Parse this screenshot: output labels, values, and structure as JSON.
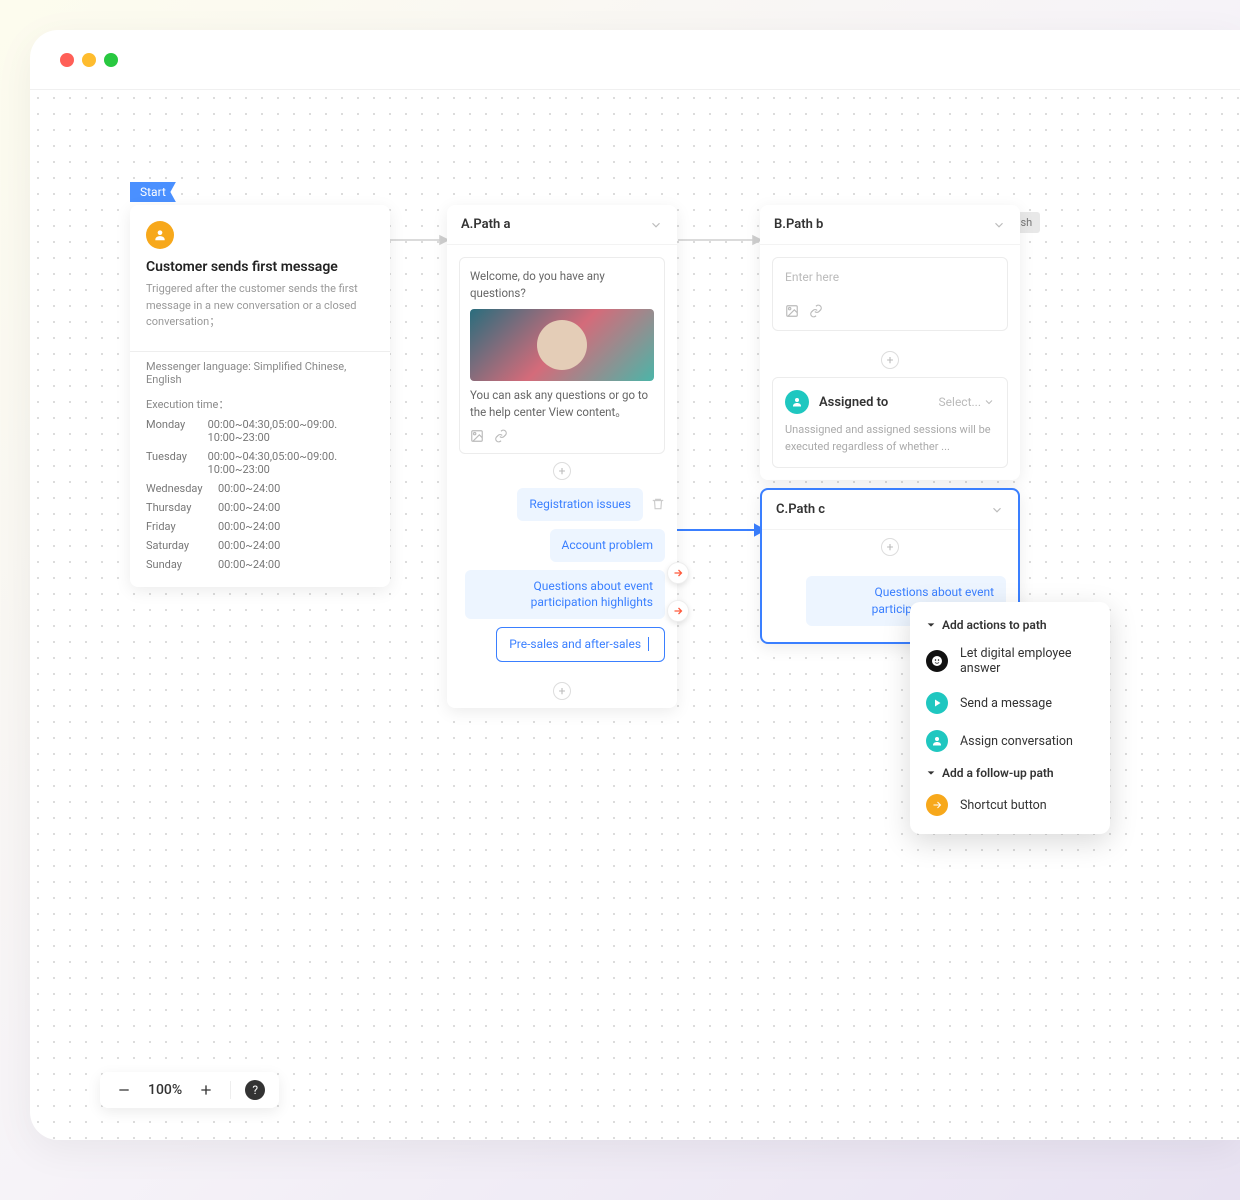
{
  "flags": {
    "start": "Start",
    "finish": "Finish"
  },
  "start_card": {
    "title": "Customer sends first message",
    "subtitle": "Triggered after the customer sends the first message in a new conversation or a closed conversation；",
    "language_label": "Messenger language: Simplified Chinese, English",
    "execution_label": "Execution time：",
    "schedule": [
      {
        "day": "Monday",
        "time": "00:00~04:30,05:00~09:00. 10:00~23:00"
      },
      {
        "day": "Tuesday",
        "time": "00:00~04:30,05:00~09:00. 10:00~23:00"
      },
      {
        "day": "Wednesday",
        "time": "00:00~24:00"
      },
      {
        "day": "Thursday",
        "time": "00:00~24:00"
      },
      {
        "day": "Friday",
        "time": "00:00~24:00"
      },
      {
        "day": "Saturday",
        "time": "00:00~24:00"
      },
      {
        "day": "Sunday",
        "time": "00:00~24:00"
      }
    ]
  },
  "path_a": {
    "title": "A.Path a",
    "welcome": "Welcome, do you have any questions?",
    "body": "You can ask any questions or go to the help center View content。",
    "chips": [
      "Registration issues",
      "Account problem",
      "Questions about event participation highlights",
      "Pre-sales and after-sales"
    ]
  },
  "path_b": {
    "title": "B.Path b",
    "placeholder": "Enter here",
    "assign_label": "Assigned to",
    "select_label": "Select...",
    "assign_desc": "Unassigned and assigned sessions will be executed regardless of whether ..."
  },
  "path_c": {
    "title": "C.Path c",
    "chip": "Questions about event participation highlights"
  },
  "ctx": {
    "h1": "Add actions to path",
    "i1": "Let digital employee answer",
    "i2": "Send a message",
    "i3": "Assign conversation",
    "h2": "Add a follow-up path",
    "i4": "Shortcut button"
  },
  "zoom": {
    "value": "100%"
  }
}
